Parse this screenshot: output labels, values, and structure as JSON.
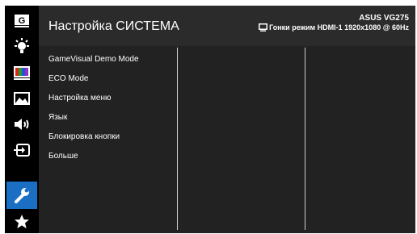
{
  "header": {
    "title": "Настройка СИСТЕМА",
    "model": "ASUS VG275",
    "status": "Гонки режим HDMI-1 1920x1080 @ 60Hz"
  },
  "menu": {
    "items": [
      "GameVisual Demo Mode",
      "ECO Mode",
      "Настройка меню",
      "Язык",
      "Блокировка кнопки",
      "Больше"
    ]
  },
  "sidebar": {
    "icons": [
      "gameplus-icon",
      "brightness-icon",
      "color-icon",
      "image-icon",
      "sound-icon",
      "input-select-icon",
      "system-setup-wrench-icon",
      "favorite-star-icon"
    ],
    "g_label": "G",
    "active_index": 6
  },
  "colors": {
    "accent": "#1a6fc4",
    "panel": "#222222",
    "header": "#2b2b2b"
  }
}
